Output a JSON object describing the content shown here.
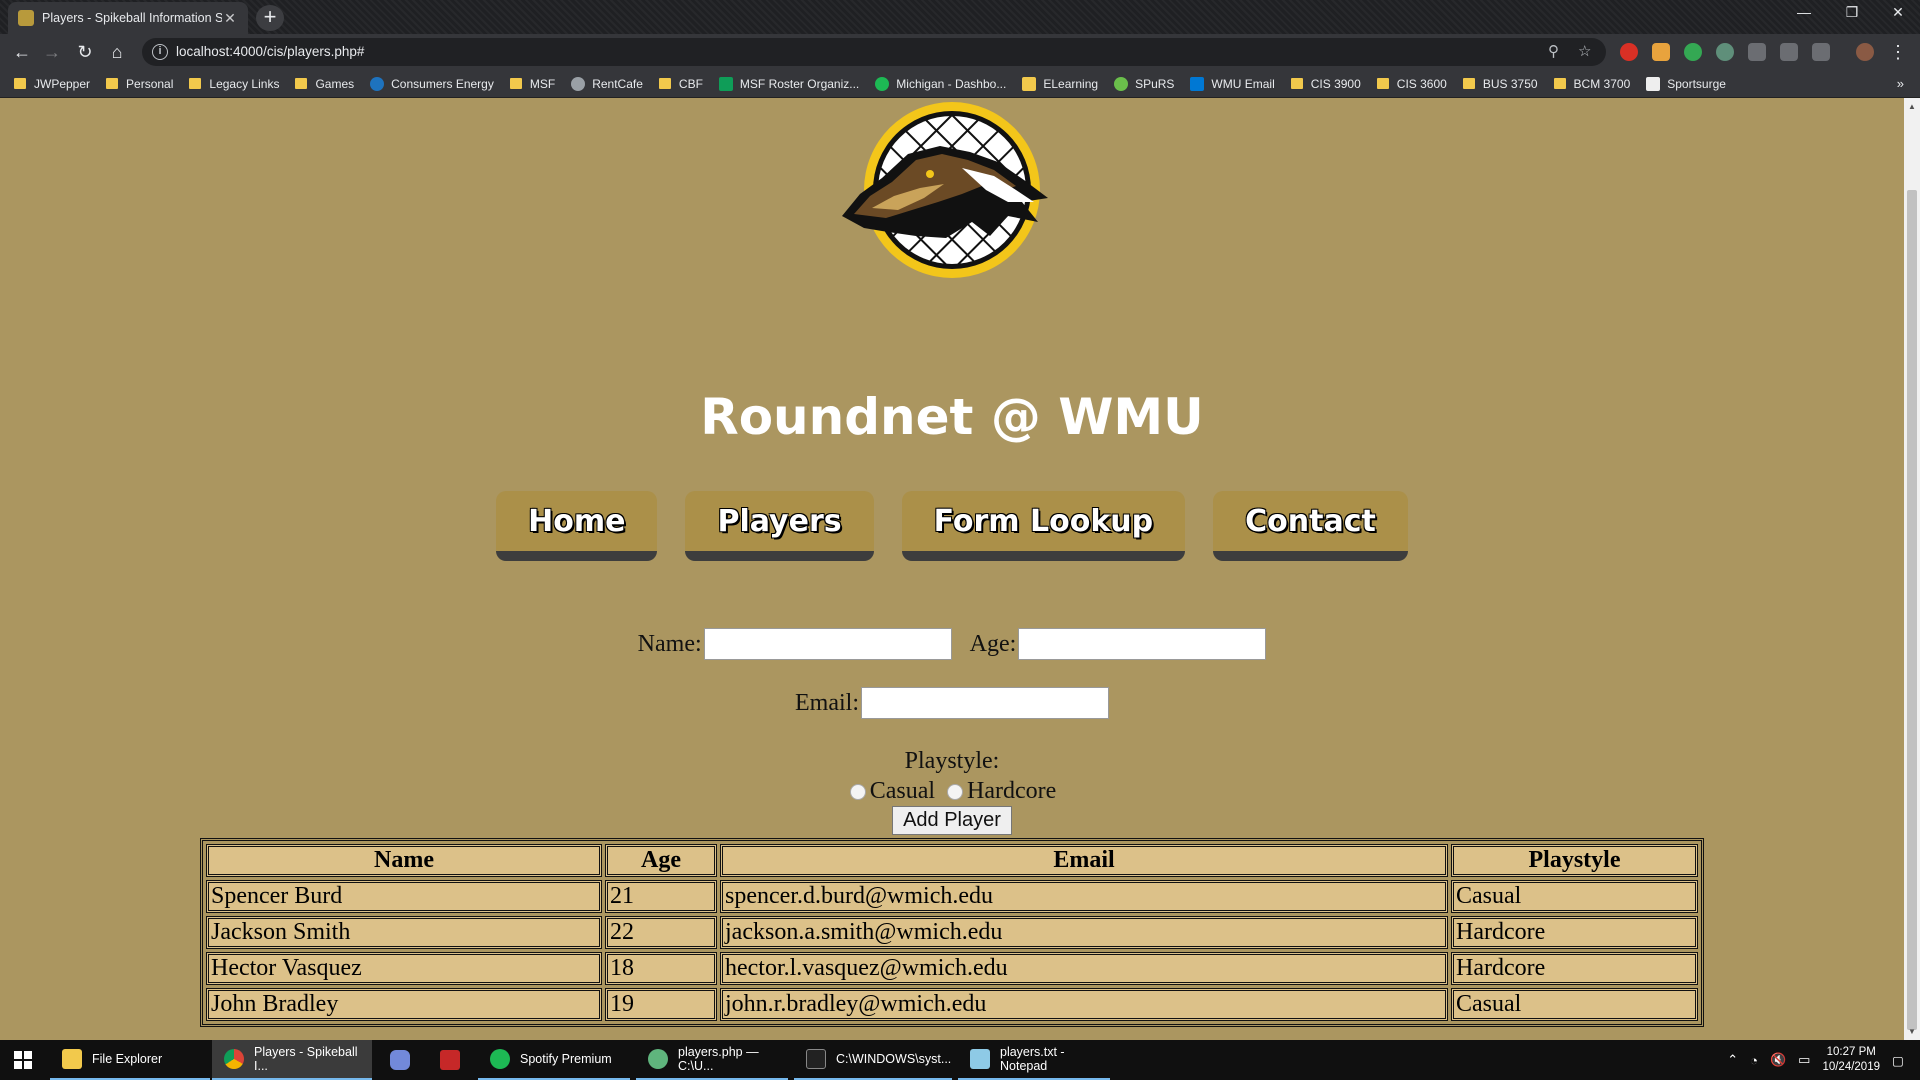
{
  "browser": {
    "tab_title": "Players - Spikeball Information S",
    "url": "localhost:4000/cis/players.php#",
    "bookmarks": [
      "JWPepper",
      "Personal",
      "Legacy Links",
      "Games",
      "Consumers Energy",
      "MSF",
      "RentCafe",
      "CBF",
      "MSF Roster Organiz...",
      "Michigan - Dashbo...",
      "ELearning",
      "SPuRS",
      "WMU Email",
      "CIS 3900",
      "CIS 3600",
      "BUS 3750",
      "BCM 3700",
      "Sportsurge"
    ]
  },
  "site": {
    "title": "Roundnet @ WMU",
    "nav": [
      "Home",
      "Players",
      "Form Lookup",
      "Contact"
    ]
  },
  "form": {
    "name_label": "Name:",
    "age_label": "Age:",
    "email_label": "Email:",
    "playstyle_label": "Playstyle:",
    "option_casual": "Casual",
    "option_hardcore": "Hardcore",
    "submit_label": "Add Player"
  },
  "table": {
    "headers": [
      "Name",
      "Age",
      "Email",
      "Playstyle"
    ],
    "rows": [
      [
        "Spencer Burd",
        "21",
        "spencer.d.burd@wmich.edu",
        "Casual"
      ],
      [
        "Jackson Smith",
        "22",
        "jackson.a.smith@wmich.edu",
        "Hardcore"
      ],
      [
        "Hector Vasquez",
        "18",
        "hector.l.vasquez@wmich.edu",
        "Hardcore"
      ],
      [
        "John Bradley",
        "19",
        "john.r.bradley@wmich.edu",
        "Casual"
      ]
    ]
  },
  "taskbar": {
    "items": [
      "File Explorer",
      "Players - Spikeball I...",
      "Spotify Premium",
      "players.php — C:\\U...",
      "C:\\WINDOWS\\syst...",
      "players.txt - Notepad"
    ],
    "time": "10:27 PM",
    "date": "10/24/2019"
  },
  "colors": {
    "page_bg": "#ab9660",
    "button_gold": "#ab9049",
    "table_cell": "#dcc189"
  }
}
